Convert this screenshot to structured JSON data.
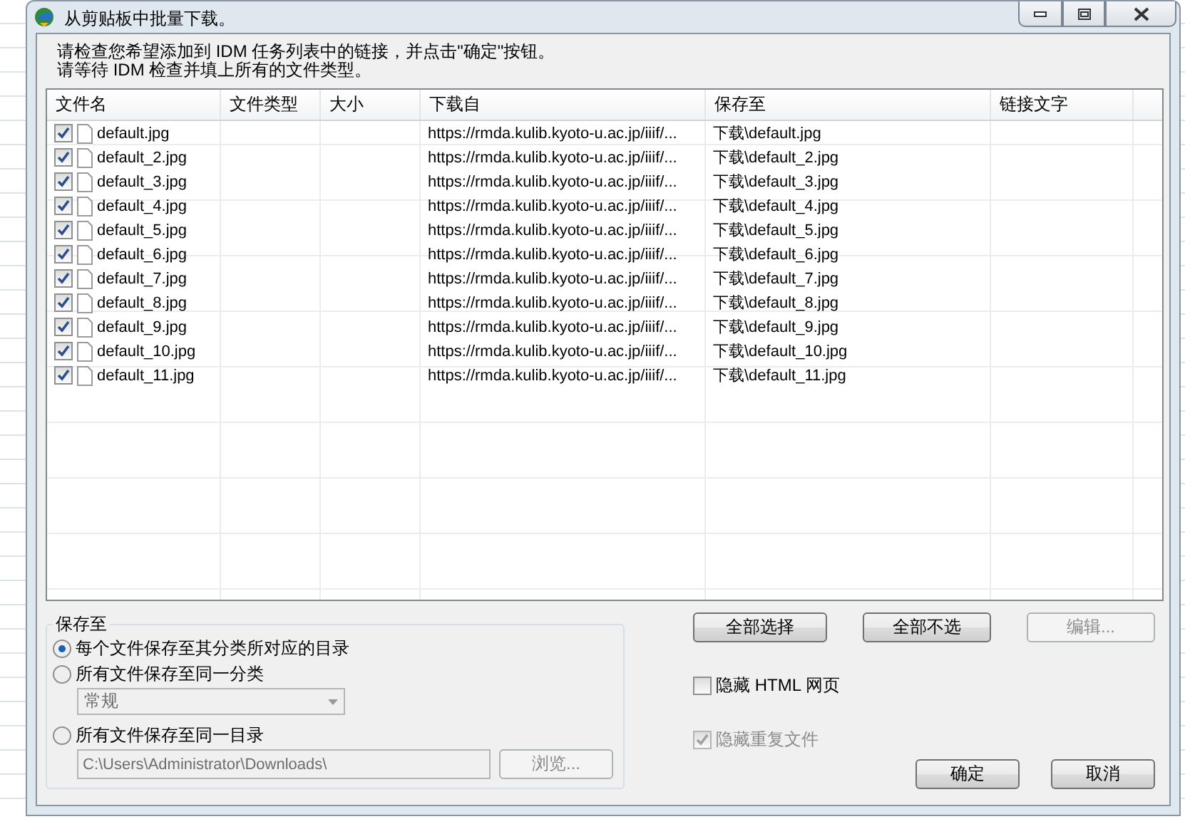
{
  "window": {
    "title": "从剪贴板中批量下载。"
  },
  "instructions": [
    "请检查您希望添加到 IDM 任务列表中的链接，并点击\"确定\"按钮。",
    "请等待 IDM 检查并填上所有的文件类型。"
  ],
  "table": {
    "columns": [
      "文件名",
      "文件类型",
      "大小",
      "下载自",
      "保存至",
      "链接文字"
    ],
    "rows": [
      {
        "checked": true,
        "file_name": "default.jpg",
        "url": "https://rmda.kulib.kyoto-u.ac.jp/iiif/...",
        "save_to": "下载\\default.jpg"
      },
      {
        "checked": true,
        "file_name": "default_2.jpg",
        "url": "https://rmda.kulib.kyoto-u.ac.jp/iiif/...",
        "save_to": "下载\\default_2.jpg"
      },
      {
        "checked": true,
        "file_name": "default_3.jpg",
        "url": "https://rmda.kulib.kyoto-u.ac.jp/iiif/...",
        "save_to": "下载\\default_3.jpg"
      },
      {
        "checked": true,
        "file_name": "default_4.jpg",
        "url": "https://rmda.kulib.kyoto-u.ac.jp/iiif/...",
        "save_to": "下载\\default_4.jpg"
      },
      {
        "checked": true,
        "file_name": "default_5.jpg",
        "url": "https://rmda.kulib.kyoto-u.ac.jp/iiif/...",
        "save_to": "下载\\default_5.jpg"
      },
      {
        "checked": true,
        "file_name": "default_6.jpg",
        "url": "https://rmda.kulib.kyoto-u.ac.jp/iiif/...",
        "save_to": "下载\\default_6.jpg"
      },
      {
        "checked": true,
        "file_name": "default_7.jpg",
        "url": "https://rmda.kulib.kyoto-u.ac.jp/iiif/...",
        "save_to": "下载\\default_7.jpg"
      },
      {
        "checked": true,
        "file_name": "default_8.jpg",
        "url": "https://rmda.kulib.kyoto-u.ac.jp/iiif/...",
        "save_to": "下载\\default_8.jpg"
      },
      {
        "checked": true,
        "file_name": "default_9.jpg",
        "url": "https://rmda.kulib.kyoto-u.ac.jp/iiif/...",
        "save_to": "下载\\default_9.jpg"
      },
      {
        "checked": true,
        "file_name": "default_10.jpg",
        "url": "https://rmda.kulib.kyoto-u.ac.jp/iiif/...",
        "save_to": "下载\\default_10.jpg"
      },
      {
        "checked": true,
        "file_name": "default_11.jpg",
        "url": "https://rmda.kulib.kyoto-u.ac.jp/iiif/...",
        "save_to": "下载\\default_11.jpg"
      }
    ]
  },
  "save_group": {
    "title": "保存至",
    "options": [
      {
        "label": "每个文件保存至其分类所对应的目录",
        "selected": true,
        "kind": "plain"
      },
      {
        "label": "所有文件保存至同一分类",
        "selected": false,
        "kind": "category"
      },
      {
        "label": "所有文件保存至同一目录",
        "selected": false,
        "kind": "directory"
      }
    ],
    "category_select": {
      "value": "常规",
      "disabled": true
    },
    "directory_field": {
      "value": "C:\\Users\\Administrator\\Downloads\\",
      "disabled": true
    },
    "browse_button": {
      "label": "浏览...",
      "disabled": true
    }
  },
  "list_buttons": [
    {
      "label": "全部选择",
      "disabled": false
    },
    {
      "label": "全部不选",
      "disabled": false
    },
    {
      "label": "编辑...",
      "disabled": true
    }
  ],
  "checkboxes": [
    {
      "label": "隐藏 HTML 网页",
      "checked": false,
      "disabled": false
    },
    {
      "label": "隐藏重复文件",
      "checked": true,
      "disabled": true
    }
  ],
  "buttons": [
    {
      "label": "确定"
    },
    {
      "label": "取消"
    }
  ]
}
